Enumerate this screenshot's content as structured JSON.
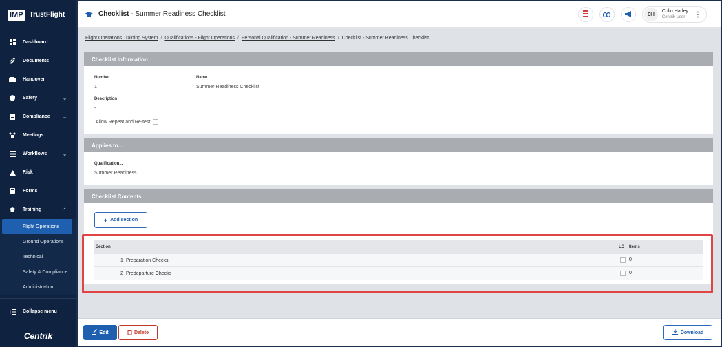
{
  "sidebar": {
    "logo_badge": "IMP",
    "logo_text": "TrustFlight",
    "items": [
      {
        "label": "Dashboard",
        "icon": "dashboard-icon"
      },
      {
        "label": "Documents",
        "icon": "paperclip-icon"
      },
      {
        "label": "Handover",
        "icon": "handover-icon"
      },
      {
        "label": "Safety",
        "icon": "shield-icon",
        "chevron": "⌄"
      },
      {
        "label": "Compliance",
        "icon": "compliance-icon",
        "chevron": "⌄"
      },
      {
        "label": "Meetings",
        "icon": "meetings-icon"
      },
      {
        "label": "Workflows",
        "icon": "workflows-icon",
        "chevron": "⌄"
      },
      {
        "label": "Risk",
        "icon": "risk-icon"
      },
      {
        "label": "Forms",
        "icon": "forms-icon"
      },
      {
        "label": "Training",
        "icon": "graduation-cap-icon",
        "chevron": "⌃"
      }
    ],
    "subitems": [
      "Flight Operations",
      "Ground Operations",
      "Technical",
      "Safety & Compliance",
      "Administration"
    ],
    "collapse_label": "Collapse menu",
    "brand": "Centrik"
  },
  "header": {
    "title": "Checklist",
    "subtitle": "- Summer Readiness Checklist",
    "user_initials": "CH",
    "user_name": "Colin Harley",
    "user_role": "Centrik User"
  },
  "breadcrumbs": [
    "Flight Operations Training System",
    "Qualifications - Flight Operations",
    "Personal Qualification - Summer Readiness",
    "Checklist - Summer Readiness Checklist"
  ],
  "checklist_info": {
    "heading": "Checklist Information",
    "number_label": "Number",
    "number_value": "1",
    "name_label": "Name",
    "name_value": "Summer Readiness Checklist",
    "description_label": "Description",
    "description_value": "-",
    "allow_label": "Allow Repeat and Re-test:"
  },
  "applies_to": {
    "heading": "Applies to...",
    "qualification_label": "Qualification...",
    "qualification_value": "Summer Readiness"
  },
  "contents": {
    "heading": "Checklist Contents",
    "add_section_label": "Add section",
    "col_section": "Section",
    "col_lc": "LC",
    "col_items": "Items",
    "rows": [
      {
        "num": "1",
        "name": "Preparation Checks",
        "items": "0"
      },
      {
        "num": "2",
        "name": "Predeparture Checks",
        "items": "0"
      }
    ]
  },
  "footer": {
    "edit_label": "Edit",
    "delete_label": "Delete",
    "download_label": "Download"
  },
  "colors": {
    "sidebar_bg": "#0f2340",
    "accent": "#1f5fb0",
    "highlight": "#e04444",
    "danger": "#c0392b"
  }
}
